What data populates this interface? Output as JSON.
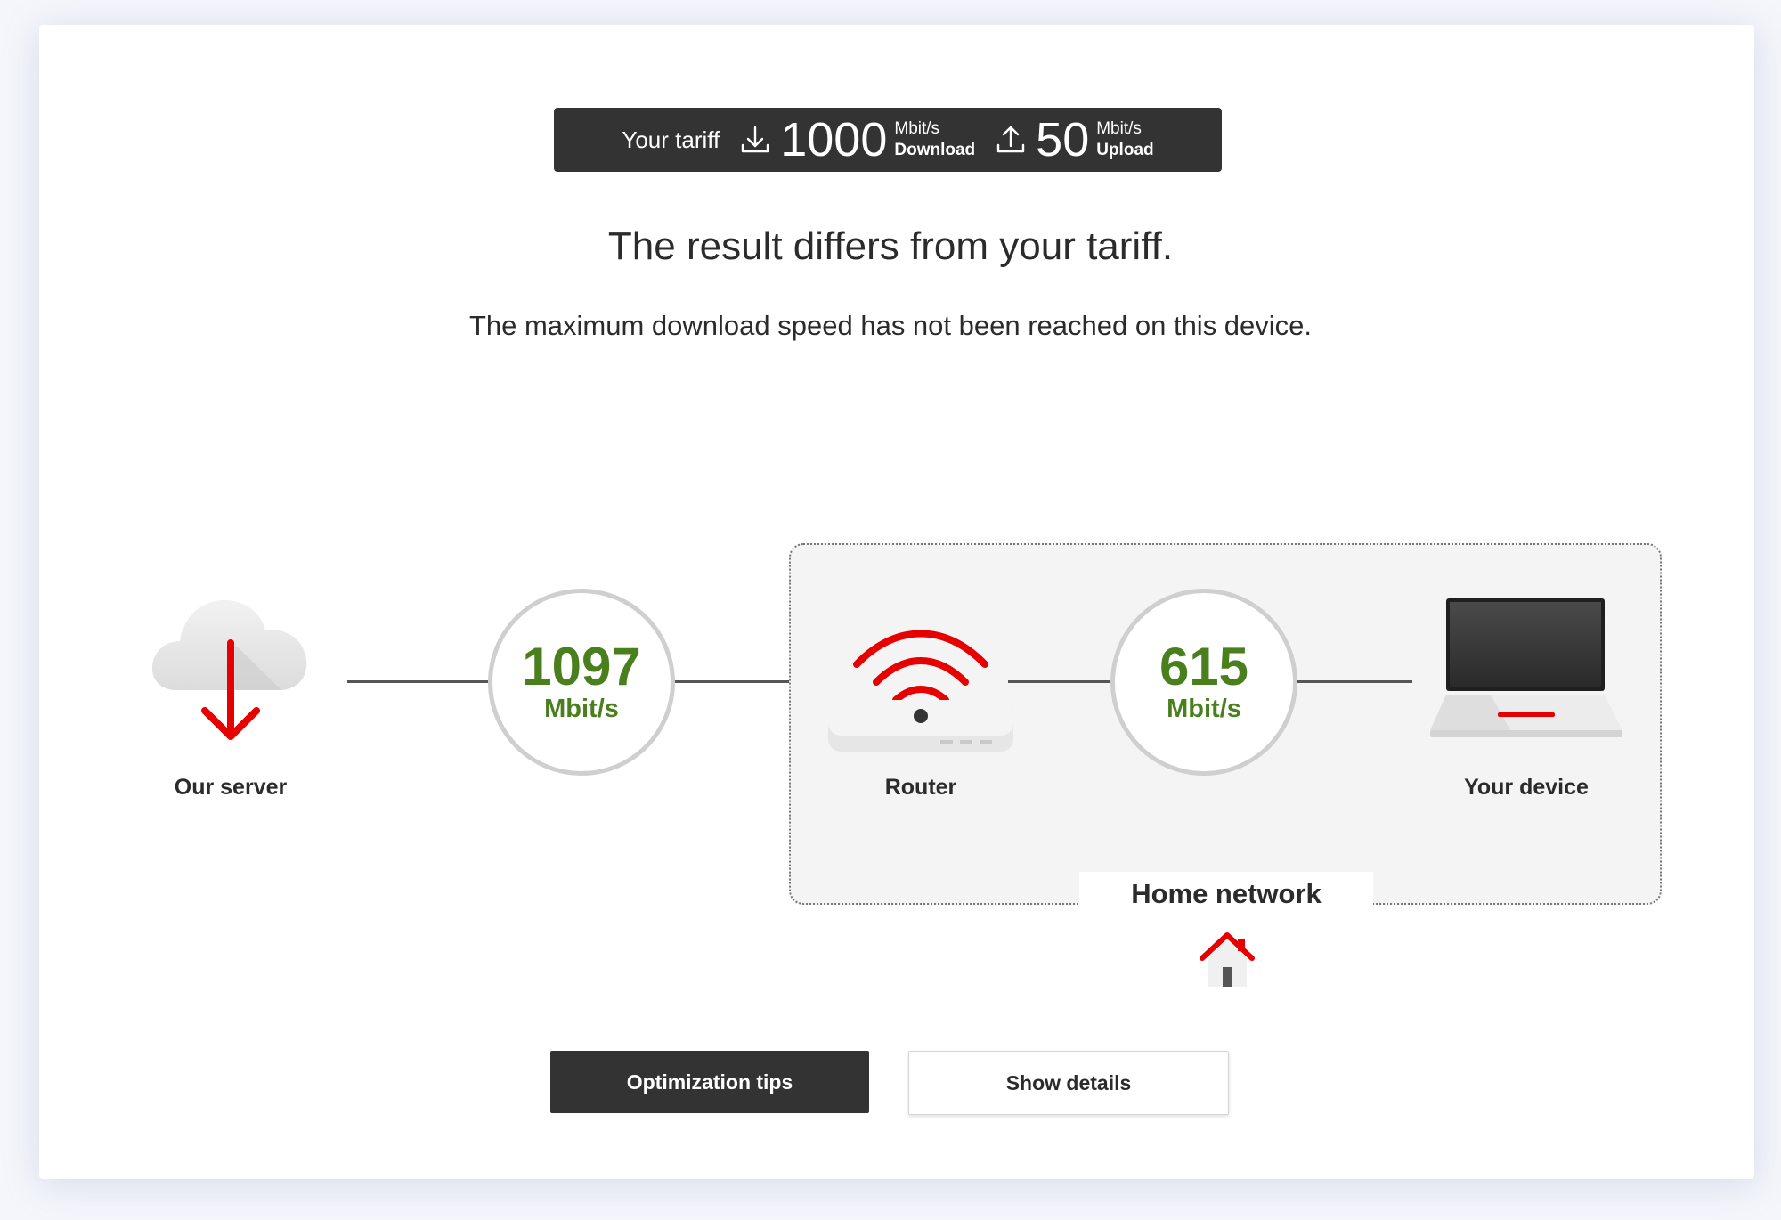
{
  "tariff": {
    "label": "Your tariff",
    "download_value": "1000",
    "download_unit": "Mbit/s",
    "download_label": "Download",
    "upload_value": "50",
    "upload_unit": "Mbit/s",
    "upload_label": "Upload"
  },
  "result": {
    "headline": "The result differs from your tariff.",
    "message": "The maximum download speed has not been reached on this device."
  },
  "diagram": {
    "server_label": "Our server",
    "server_speed": "1097",
    "server_speed_unit": "Mbit/s",
    "router_label": "Router",
    "device_speed": "615",
    "device_speed_unit": "Mbit/s",
    "device_label": "Your device",
    "home_network_label": "Home network"
  },
  "buttons": {
    "optimization": "Optimization tips",
    "details": "Show details"
  },
  "colors": {
    "accent_red": "#e60000",
    "speed_green": "#4a7f1e",
    "dark": "#333333"
  },
  "icons": {
    "server": "cloud-download-icon",
    "router": "router-wifi-icon",
    "device": "laptop-icon",
    "home": "house-icon",
    "download": "download-arrow-icon",
    "upload": "upload-arrow-icon"
  }
}
